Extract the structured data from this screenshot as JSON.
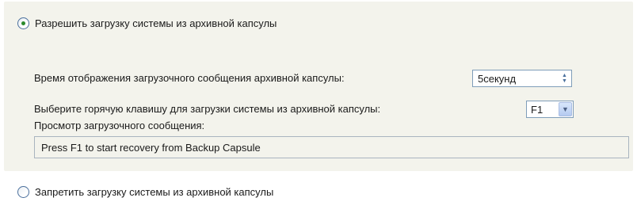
{
  "options": {
    "allow_label": "Разрешить загрузку системы из архивной капсулы",
    "allow_selected": true,
    "deny_label": "Запретить загрузку системы из архивной капсулы",
    "deny_selected": false
  },
  "display_time": {
    "label": "Время отображения загрузочного сообщения архивной капсулы:",
    "value": "5секунд"
  },
  "hotkey": {
    "label": "Выберите горячую клавишу для загрузки системы из архивной капсулы:",
    "value": "F1"
  },
  "preview": {
    "label": "Просмотр загрузочного сообщения:",
    "text": "Press F1 to start recovery from Backup Capsule"
  },
  "colors": {
    "panel_bg": "#f3f3ec",
    "radio_dot": "#2a8a2a",
    "field_border": "#7f9db9"
  }
}
